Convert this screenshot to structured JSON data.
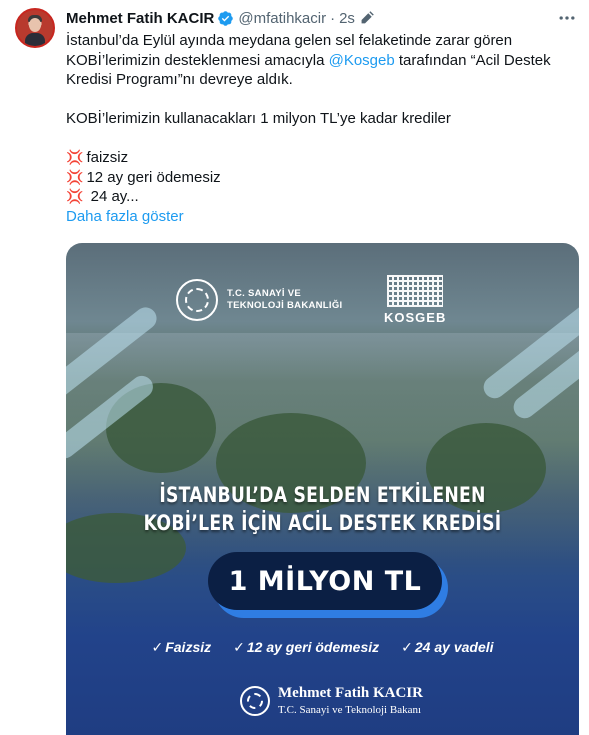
{
  "tweet": {
    "author_name": "Mehmet Fatih KACIR",
    "handle": "@mfatihkacir",
    "separator": "·",
    "time": "2s",
    "text_line1": "İstanbul’da Eylül ayında meydana gelen sel felaketinde zarar gören",
    "text_line2": "KOBİ’lerimizin desteklenmesi amacıyla ",
    "mention": "@Kosgeb",
    "text_line2_after": " tarafından “Acil Destek",
    "text_line3": "Kredisi Programı”nı devreye aldık.",
    "text_line4": "KOBİ’lerimizin kullanacakları 1 milyon TL’ye kadar krediler",
    "bullet_1": "faizsiz",
    "bullet_2": "12 ay geri ödemesiz",
    "bullet_3": " 24 ay...",
    "bullet_icon": "💢",
    "show_more": "Daha fazla göster"
  },
  "media": {
    "ministry_line1": "T.C. SANAYİ VE",
    "ministry_line2": "TEKNOLOJİ BAKANLIĞI",
    "kosgeb": "KOSGEB",
    "headline_line1": "İSTANBUL’DA SELDEN ETKİLENEN",
    "headline_line2": "KOBİ’LER İÇİN ACİL DESTEK KREDİSİ",
    "amount": "1 MİLYON TL",
    "feature_1": "Faizsiz",
    "feature_2": "12 ay geri ödemesiz",
    "feature_3": "24 ay vadeli",
    "check": "✓",
    "signer_name": "Mehmet Fatih KACIR",
    "signer_title": "T.C. Sanayi ve Teknoloji Bakanı"
  },
  "colors": {
    "link": "#1d9bf0",
    "verified": "#1d9bf0",
    "muted": "#536471",
    "pill": "#0b1f44",
    "pill_shadow": "#2f7de3"
  },
  "icons": [
    "verified-badge-icon",
    "edit-icon",
    "more-icon",
    "anger-symbol-icon",
    "ministry-seal-icon",
    "kosgeb-logo-icon"
  ]
}
